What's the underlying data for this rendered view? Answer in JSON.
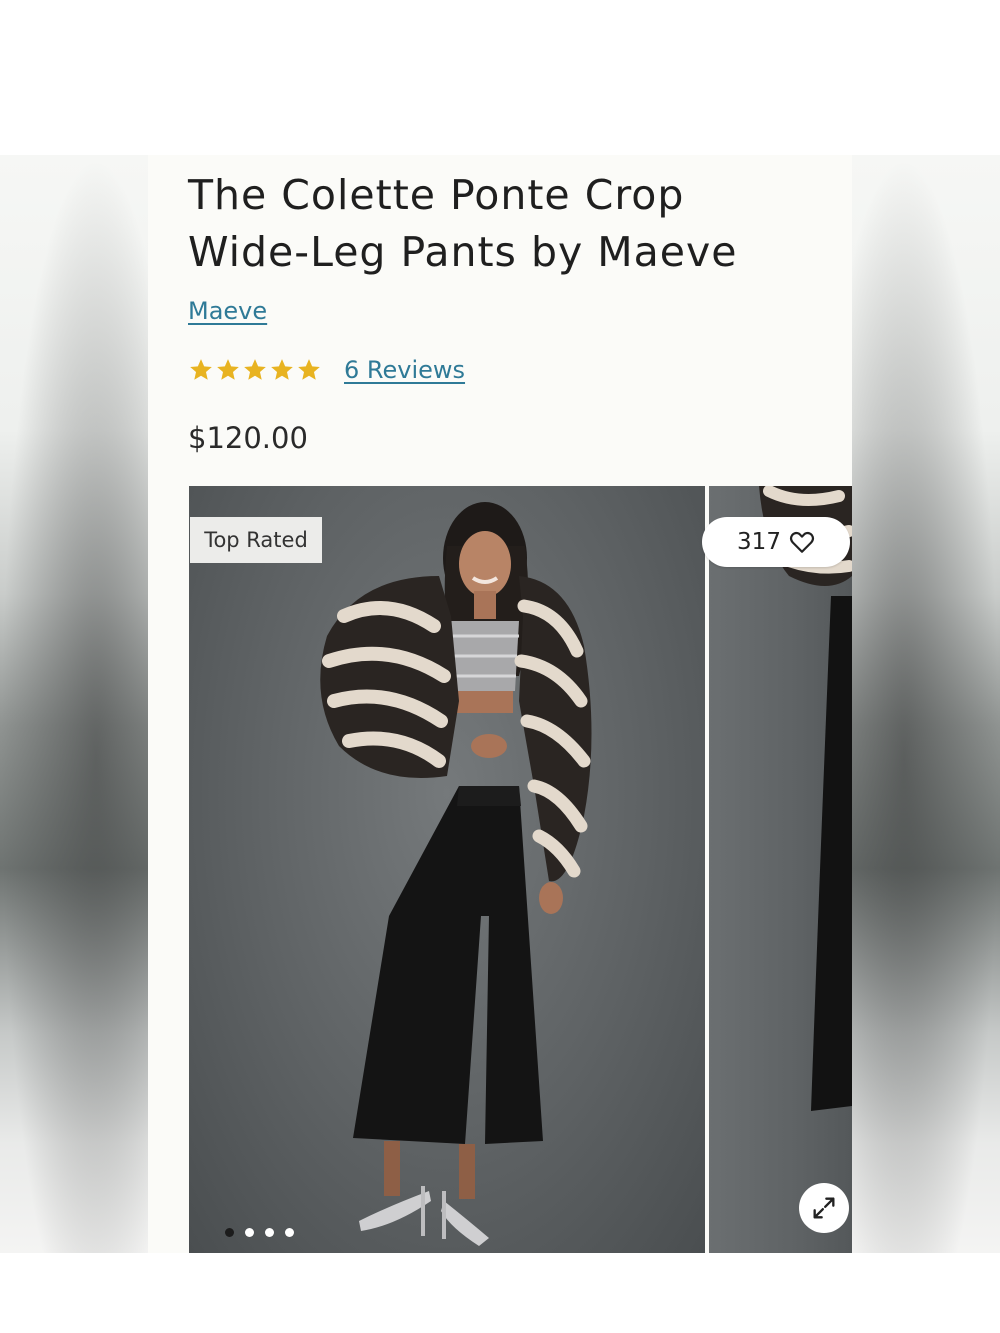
{
  "product": {
    "title_line1": "The Colette Ponte Crop",
    "title_line2": "Wide-Leg Pants by Maeve",
    "brand": "Maeve",
    "rating": 5,
    "reviews_label": "6 Reviews",
    "price": "$120.00"
  },
  "gallery": {
    "badge": "Top Rated",
    "favorites_count": "317",
    "slide_count": 4,
    "active_slide": 1
  },
  "colors": {
    "link": "#2f7a97",
    "star": "#e8b321",
    "panel_bg": "#fbfbf8"
  },
  "icons": {
    "favorite": "heart-outline-icon",
    "expand": "expand-arrows-icon",
    "rating": "star-icon"
  }
}
